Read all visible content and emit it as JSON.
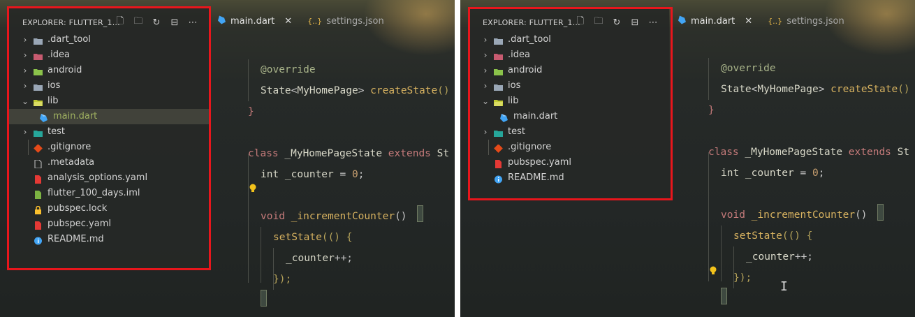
{
  "explorer": {
    "title": "EXPLORER: FLUTTER_1...",
    "actions": [
      {
        "name": "new-file-icon",
        "glyph": "🗋"
      },
      {
        "name": "new-folder-icon",
        "glyph": "🗀"
      },
      {
        "name": "refresh-icon",
        "glyph": "↻"
      },
      {
        "name": "collapse-all-icon",
        "glyph": "⊟"
      },
      {
        "name": "more-actions-icon",
        "glyph": "⋯"
      }
    ]
  },
  "tabs": [
    {
      "label": "main.dart",
      "icon": "dart-icon",
      "close": "✕",
      "active": true
    },
    {
      "label": "settings.json",
      "icon": "json-icon",
      "prefix": "{..}",
      "active": false
    }
  ],
  "panels": [
    {
      "tree": [
        {
          "label": ".dart_tool",
          "kind": "folder",
          "chevron": "›",
          "icon": "folder-icon",
          "iconColor": "#9aa7b6"
        },
        {
          "label": ".idea",
          "kind": "folder",
          "chevron": "›",
          "icon": "idea-folder-icon",
          "iconColor": "#c85b70"
        },
        {
          "label": "android",
          "kind": "folder",
          "chevron": "›",
          "icon": "android-folder-icon",
          "iconColor": "#8bc34a"
        },
        {
          "label": "ios",
          "kind": "folder",
          "chevron": "›",
          "icon": "ios-folder-icon",
          "iconColor": "#9aa7b6"
        },
        {
          "label": "lib",
          "kind": "folder-open",
          "chevron": "⌄",
          "icon": "lib-folder-icon",
          "iconColor": "#c0ca33"
        },
        {
          "label": "main.dart",
          "kind": "file",
          "child": true,
          "selected": true,
          "icon": "dart-file-icon",
          "iconColor": "#42a5f5"
        },
        {
          "label": "test",
          "kind": "folder",
          "chevron": "›",
          "icon": "test-folder-icon",
          "iconColor": "#26a69a"
        },
        {
          "label": ".gitignore",
          "kind": "file",
          "icon": "git-icon",
          "iconColor": "#e64a19"
        },
        {
          "label": ".metadata",
          "kind": "file",
          "icon": "file-icon",
          "iconColor": "#c8c8c8"
        },
        {
          "label": "analysis_options.yaml",
          "kind": "file",
          "icon": "yaml-icon",
          "iconColor": "#e53935"
        },
        {
          "label": "flutter_100_days.iml",
          "kind": "file",
          "icon": "iml-icon",
          "iconColor": "#7cb342"
        },
        {
          "label": "pubspec.lock",
          "kind": "file",
          "icon": "lock-icon",
          "iconColor": "#fbc02d"
        },
        {
          "label": "pubspec.yaml",
          "kind": "file",
          "icon": "yaml-icon",
          "iconColor": "#e53935"
        },
        {
          "label": "README.md",
          "kind": "file",
          "icon": "info-icon",
          "iconColor": "#42a5f5"
        }
      ]
    },
    {
      "tree": [
        {
          "label": ".dart_tool",
          "kind": "folder",
          "chevron": "›",
          "icon": "folder-icon",
          "iconColor": "#9aa7b6"
        },
        {
          "label": ".idea",
          "kind": "folder",
          "chevron": "›",
          "icon": "idea-folder-icon",
          "iconColor": "#c85b70"
        },
        {
          "label": "android",
          "kind": "folder",
          "chevron": "›",
          "icon": "android-folder-icon",
          "iconColor": "#8bc34a"
        },
        {
          "label": "ios",
          "kind": "folder",
          "chevron": "›",
          "icon": "ios-folder-icon",
          "iconColor": "#9aa7b6"
        },
        {
          "label": "lib",
          "kind": "folder-open",
          "chevron": "⌄",
          "icon": "lib-folder-icon",
          "iconColor": "#c0ca33"
        },
        {
          "label": "main.dart",
          "kind": "file",
          "child": true,
          "selected": false,
          "icon": "dart-file-icon",
          "iconColor": "#42a5f5"
        },
        {
          "label": "test",
          "kind": "folder",
          "chevron": "›",
          "icon": "test-folder-icon",
          "iconColor": "#26a69a"
        },
        {
          "label": ".gitignore",
          "kind": "file",
          "icon": "git-icon",
          "iconColor": "#e64a19"
        },
        {
          "label": "pubspec.yaml",
          "kind": "file",
          "icon": "yaml-icon",
          "iconColor": "#e53935"
        },
        {
          "label": "README.md",
          "kind": "file",
          "icon": "info-icon",
          "iconColor": "#42a5f5"
        }
      ]
    }
  ],
  "code": {
    "lines": [
      [
        {
          "t": "@override",
          "c": "anno"
        }
      ],
      [
        {
          "t": "State",
          "c": "type"
        },
        {
          "t": "<",
          "c": "pun"
        },
        {
          "t": "MyHomePage",
          "c": "type"
        },
        {
          "t": "> ",
          "c": "pun"
        },
        {
          "t": "createState",
          "c": "fn"
        },
        {
          "t": "()",
          "c": "paren"
        }
      ],
      [
        {
          "t": "}",
          "c": "brace"
        }
      ],
      [],
      [
        {
          "t": "class ",
          "c": "kw"
        },
        {
          "t": "_MyHomePageState ",
          "c": "type"
        },
        {
          "t": "extends ",
          "c": "kw"
        },
        {
          "t": "St",
          "c": "type"
        }
      ],
      [
        {
          "t": "int ",
          "c": "type"
        },
        {
          "t": "_counter ",
          "c": "type"
        },
        {
          "t": "= ",
          "c": "pun"
        },
        {
          "t": "0",
          "c": "num"
        },
        {
          "t": ";",
          "c": "pun"
        }
      ],
      [],
      [
        {
          "t": "void ",
          "c": "kw"
        },
        {
          "t": "_incrementCounter",
          "c": "fn"
        },
        {
          "t": "()",
          "c": "pun"
        }
      ],
      [
        {
          "t": "setState",
          "c": "fn"
        },
        {
          "t": "(() {",
          "c": "paren"
        }
      ],
      [
        {
          "t": "_counter",
          "c": "type"
        },
        {
          "t": "++;",
          "c": "pun"
        }
      ],
      [
        {
          "t": "});",
          "c": "paren"
        }
      ]
    ],
    "indents": [
      1,
      1,
      0,
      0,
      0,
      1,
      0,
      1,
      2,
      3,
      2
    ]
  },
  "colors": {
    "highlight": "#e8161c",
    "lightbulb": "#f2c21b"
  }
}
